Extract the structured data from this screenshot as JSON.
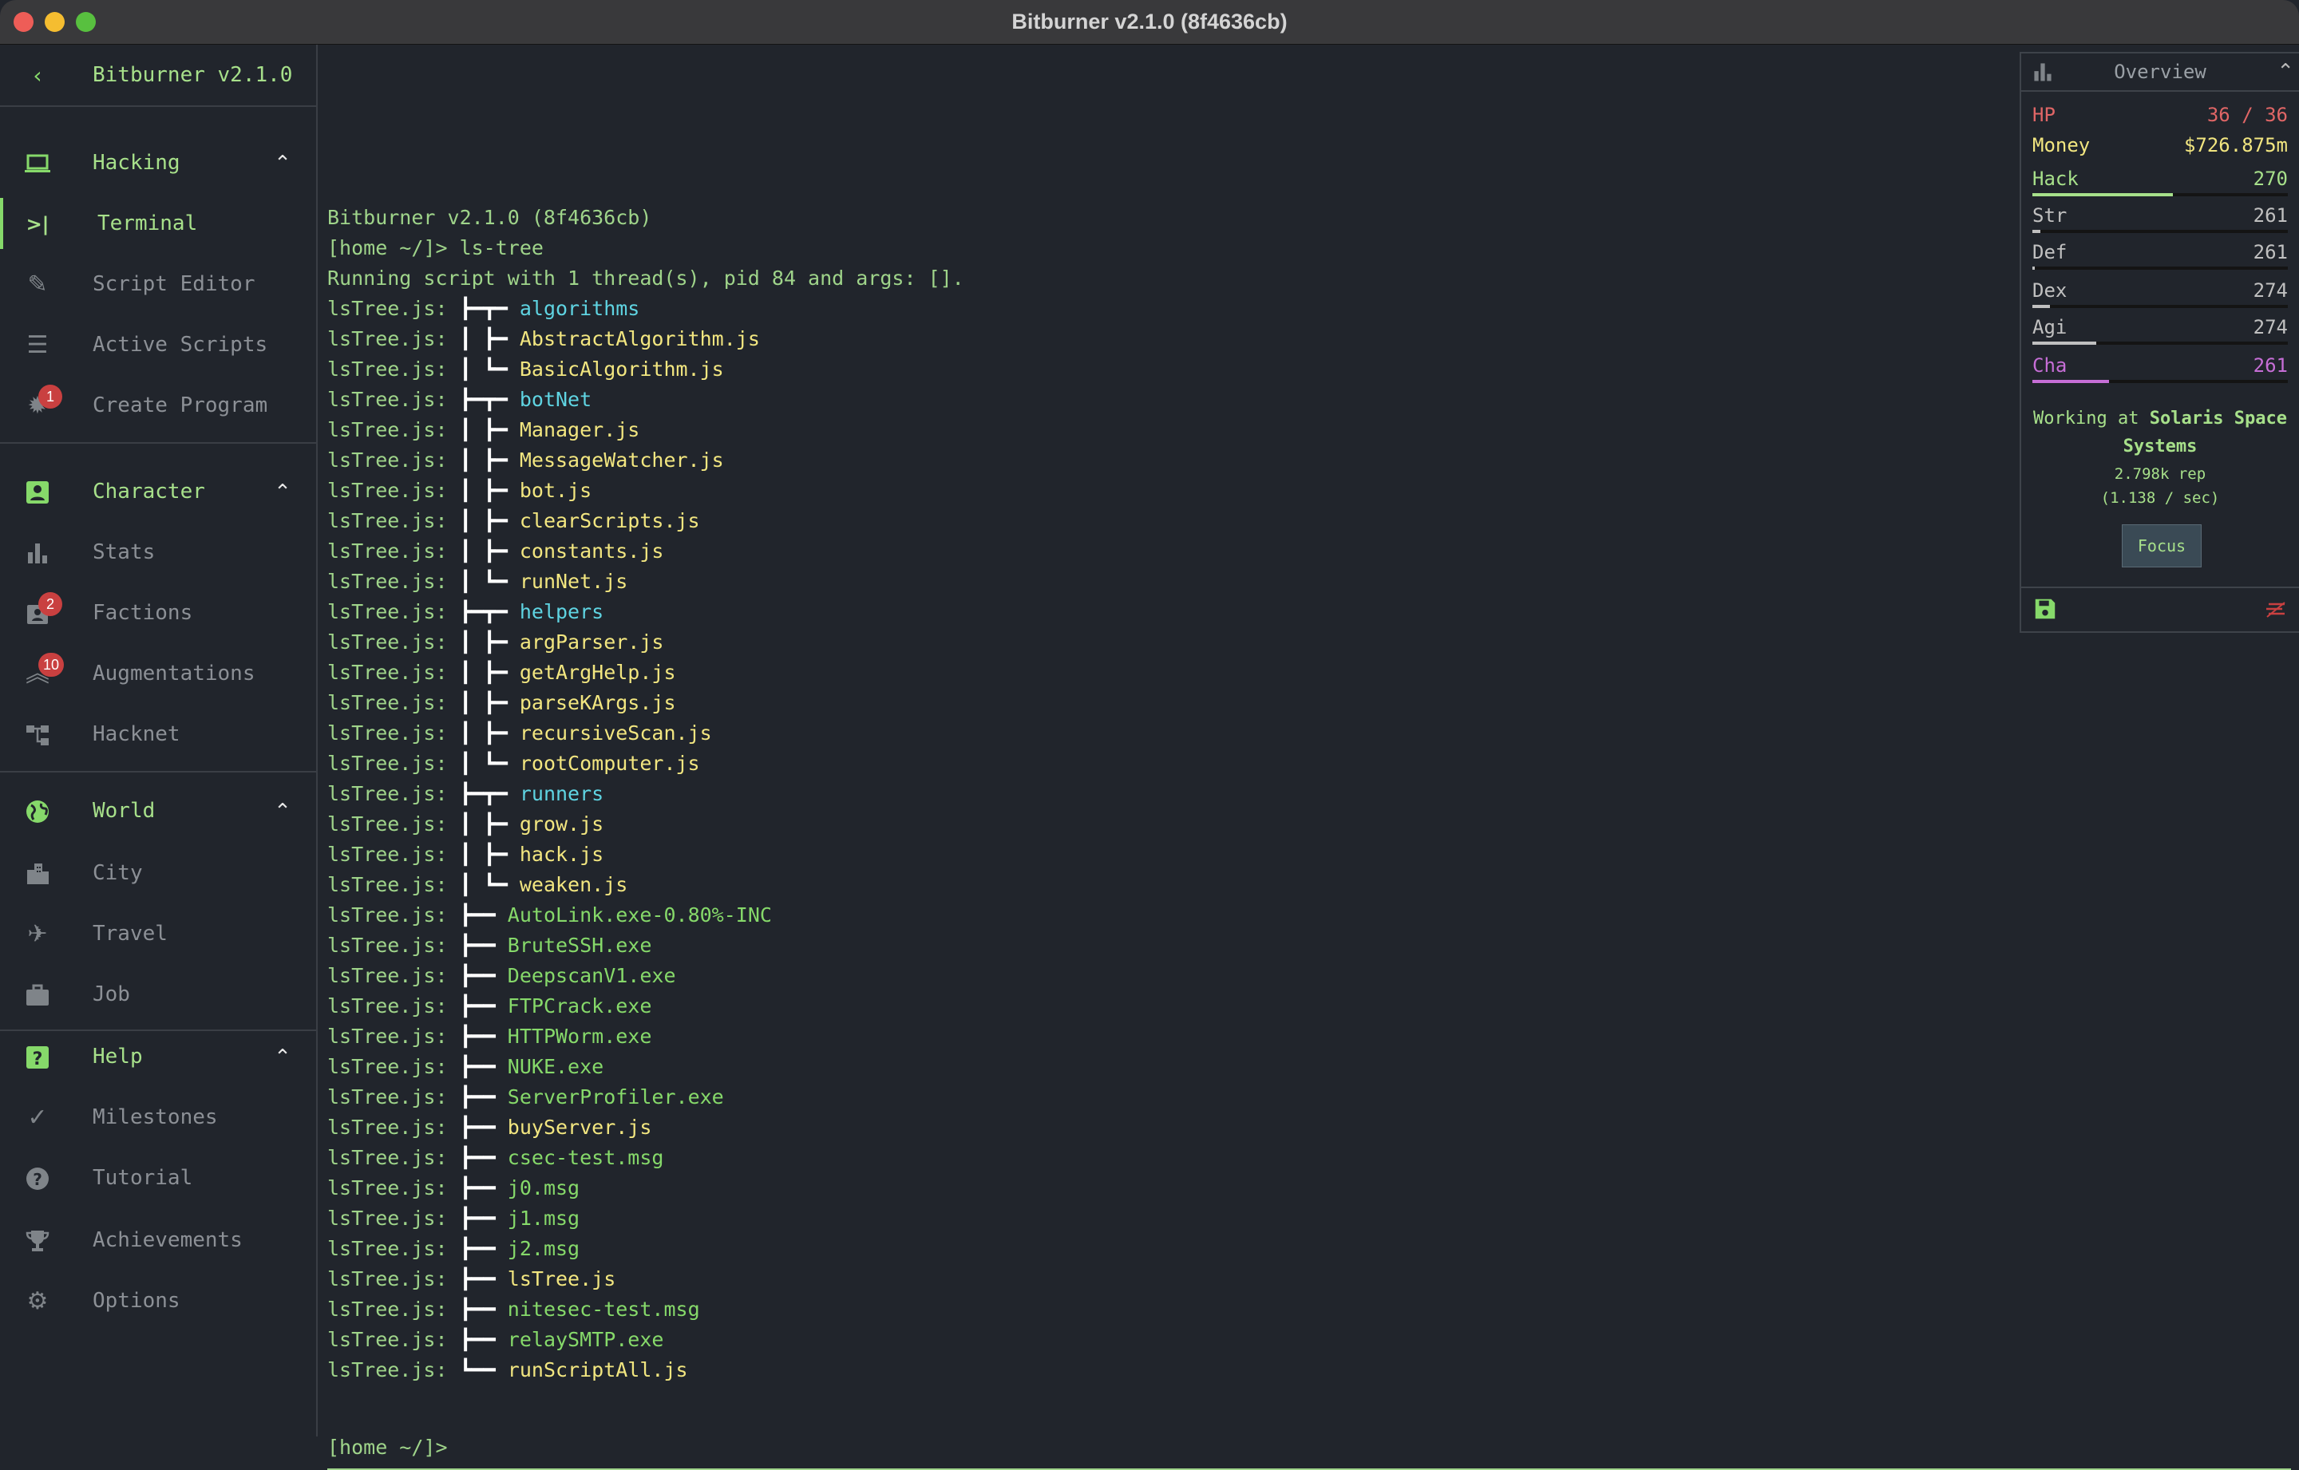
{
  "window": {
    "title": "Bitburner v2.1.0 (8f4636cb)"
  },
  "sidebar": {
    "version": "Bitburner v2.1.0",
    "sections": [
      {
        "label": "Hacking",
        "items": [
          {
            "label": "Terminal"
          },
          {
            "label": "Script Editor"
          },
          {
            "label": "Active Scripts"
          },
          {
            "label": "Create Program",
            "badge": "1"
          }
        ]
      },
      {
        "label": "Character",
        "items": [
          {
            "label": "Stats"
          },
          {
            "label": "Factions",
            "badge": "2"
          },
          {
            "label": "Augmentations",
            "badge": "10"
          },
          {
            "label": "Hacknet"
          }
        ]
      },
      {
        "label": "World",
        "items": [
          {
            "label": "City"
          },
          {
            "label": "Travel"
          },
          {
            "label": "Job"
          }
        ]
      },
      {
        "label": "Help",
        "items": [
          {
            "label": "Milestones"
          },
          {
            "label": "Tutorial"
          },
          {
            "label": "Achievements"
          },
          {
            "label": "Options"
          }
        ]
      }
    ]
  },
  "terminal": {
    "lines": [
      {
        "text": "Bitburner v2.1.0 (8f4636cb)"
      },
      {
        "text": "[home ~/]> ls-tree"
      },
      {
        "text": "Running script with 1 thread(s), pid 84 and args: []."
      },
      {
        "prefix": "lsTree.js: ",
        "tree": "┣━┳━ ",
        "name": "algorithms",
        "kind": "dir"
      },
      {
        "prefix": "lsTree.js: ",
        "tree": "┃ ┣━ ",
        "name": "AbstractAlgorithm.js",
        "kind": "js"
      },
      {
        "prefix": "lsTree.js: ",
        "tree": "┃ ┗━ ",
        "name": "BasicAlgorithm.js",
        "kind": "js"
      },
      {
        "prefix": "lsTree.js: ",
        "tree": "┣━┳━ ",
        "name": "botNet",
        "kind": "dir"
      },
      {
        "prefix": "lsTree.js: ",
        "tree": "┃ ┣━ ",
        "name": "Manager.js",
        "kind": "js"
      },
      {
        "prefix": "lsTree.js: ",
        "tree": "┃ ┣━ ",
        "name": "MessageWatcher.js",
        "kind": "js"
      },
      {
        "prefix": "lsTree.js: ",
        "tree": "┃ ┣━ ",
        "name": "bot.js",
        "kind": "js"
      },
      {
        "prefix": "lsTree.js: ",
        "tree": "┃ ┣━ ",
        "name": "clearScripts.js",
        "kind": "js"
      },
      {
        "prefix": "lsTree.js: ",
        "tree": "┃ ┣━ ",
        "name": "constants.js",
        "kind": "js"
      },
      {
        "prefix": "lsTree.js: ",
        "tree": "┃ ┗━ ",
        "name": "runNet.js",
        "kind": "js"
      },
      {
        "prefix": "lsTree.js: ",
        "tree": "┣━┳━ ",
        "name": "helpers",
        "kind": "dir"
      },
      {
        "prefix": "lsTree.js: ",
        "tree": "┃ ┣━ ",
        "name": "argParser.js",
        "kind": "js"
      },
      {
        "prefix": "lsTree.js: ",
        "tree": "┃ ┣━ ",
        "name": "getArgHelp.js",
        "kind": "js"
      },
      {
        "prefix": "lsTree.js: ",
        "tree": "┃ ┣━ ",
        "name": "parseKArgs.js",
        "kind": "js"
      },
      {
        "prefix": "lsTree.js: ",
        "tree": "┃ ┣━ ",
        "name": "recursiveScan.js",
        "kind": "js"
      },
      {
        "prefix": "lsTree.js: ",
        "tree": "┃ ┗━ ",
        "name": "rootComputer.js",
        "kind": "js"
      },
      {
        "prefix": "lsTree.js: ",
        "tree": "┣━┳━ ",
        "name": "runners",
        "kind": "dir"
      },
      {
        "prefix": "lsTree.js: ",
        "tree": "┃ ┣━ ",
        "name": "grow.js",
        "kind": "js"
      },
      {
        "prefix": "lsTree.js: ",
        "tree": "┃ ┣━ ",
        "name": "hack.js",
        "kind": "js"
      },
      {
        "prefix": "lsTree.js: ",
        "tree": "┃ ┗━ ",
        "name": "weaken.js",
        "kind": "js"
      },
      {
        "prefix": "lsTree.js: ",
        "tree": "┣━━ ",
        "name": "AutoLink.exe-0.80%-INC",
        "kind": "exe"
      },
      {
        "prefix": "lsTree.js: ",
        "tree": "┣━━ ",
        "name": "BruteSSH.exe",
        "kind": "exe"
      },
      {
        "prefix": "lsTree.js: ",
        "tree": "┣━━ ",
        "name": "DeepscanV1.exe",
        "kind": "exe"
      },
      {
        "prefix": "lsTree.js: ",
        "tree": "┣━━ ",
        "name": "FTPCrack.exe",
        "kind": "exe"
      },
      {
        "prefix": "lsTree.js: ",
        "tree": "┣━━ ",
        "name": "HTTPWorm.exe",
        "kind": "exe"
      },
      {
        "prefix": "lsTree.js: ",
        "tree": "┣━━ ",
        "name": "NUKE.exe",
        "kind": "exe"
      },
      {
        "prefix": "lsTree.js: ",
        "tree": "┣━━ ",
        "name": "ServerProfiler.exe",
        "kind": "exe"
      },
      {
        "prefix": "lsTree.js: ",
        "tree": "┣━━ ",
        "name": "buyServer.js",
        "kind": "js"
      },
      {
        "prefix": "lsTree.js: ",
        "tree": "┣━━ ",
        "name": "csec-test.msg",
        "kind": "exe"
      },
      {
        "prefix": "lsTree.js: ",
        "tree": "┣━━ ",
        "name": "j0.msg",
        "kind": "exe"
      },
      {
        "prefix": "lsTree.js: ",
        "tree": "┣━━ ",
        "name": "j1.msg",
        "kind": "exe"
      },
      {
        "prefix": "lsTree.js: ",
        "tree": "┣━━ ",
        "name": "j2.msg",
        "kind": "exe"
      },
      {
        "prefix": "lsTree.js: ",
        "tree": "┣━━ ",
        "name": "lsTree.js",
        "kind": "js"
      },
      {
        "prefix": "lsTree.js: ",
        "tree": "┣━━ ",
        "name": "nitesec-test.msg",
        "kind": "exe"
      },
      {
        "prefix": "lsTree.js: ",
        "tree": "┣━━ ",
        "name": "relaySMTP.exe",
        "kind": "exe"
      },
      {
        "prefix": "lsTree.js: ",
        "tree": "┗━━ ",
        "name": "runScriptAll.js",
        "kind": "js"
      }
    ],
    "prompt": "[home ~/]>"
  },
  "overview": {
    "title": "Overview",
    "hp": {
      "label": "HP",
      "value": "36 / 36"
    },
    "money": {
      "label": "Money",
      "value": "$726.875m"
    },
    "stats": [
      {
        "label": "Hack",
        "value": "270",
        "progress": 0.55,
        "color": "#a7e08a"
      },
      {
        "label": "Str",
        "value": "261",
        "progress": 0.03,
        "color": "#c0c0c0"
      },
      {
        "label": "Def",
        "value": "261",
        "progress": 0.01,
        "color": "#c0c0c0"
      },
      {
        "label": "Dex",
        "value": "274",
        "progress": 0.07,
        "color": "#c0c0c0"
      },
      {
        "label": "Agi",
        "value": "274",
        "progress": 0.25,
        "color": "#c0c0c0"
      },
      {
        "label": "Cha",
        "value": "261",
        "progress": 0.3,
        "color": "#c66ed6"
      }
    ],
    "work": {
      "prefix": "Working at ",
      "company": "Solaris Space Systems",
      "rep": "2.798k rep",
      "rate": "(1.138 / sec)"
    },
    "focus_label": "Focus"
  },
  "colors": {
    "hp": "#e06666",
    "money": "#f2e680",
    "text": "#9fd48a"
  }
}
